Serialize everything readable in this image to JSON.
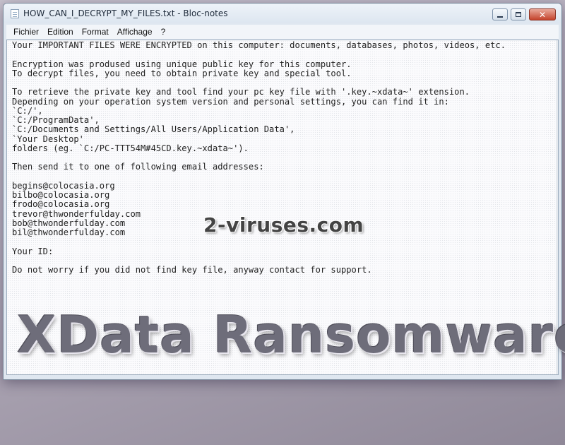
{
  "window": {
    "title": "HOW_CAN_I_DECRYPT_MY_FILES.txt - Bloc-notes",
    "app_icon": "notepad-icon",
    "controls": {
      "minimize_icon": "minimize-icon",
      "maximize_icon": "maximize-icon",
      "close_icon": "close-icon",
      "close_glyph": "✕"
    }
  },
  "menu": {
    "items": [
      {
        "label": "Fichier"
      },
      {
        "label": "Edition"
      },
      {
        "label": "Format"
      },
      {
        "label": "Affichage"
      },
      {
        "label": "?"
      }
    ]
  },
  "document": {
    "lines": [
      "Your IMPORTANT FILES WERE ENCRYPTED on this computer: documents, databases, photos, videos, etc.",
      "",
      "Encryption was prodused using unique public key for this computer.",
      "To decrypt files, you need to obtain private key and special tool.",
      "",
      "To retrieve the private key and tool find your pc key file with '.key.~xdata~' extension.",
      "Depending on your operation system version and personal settings, you can find it in:",
      "`C:/',",
      "`C:/ProgramData',",
      "`C:/Documents and Settings/All Users/Application Data',",
      "`Your Desktop'",
      "folders (eg. `C:/PC-TTT54M#45CD.key.~xdata~').",
      "",
      "Then send it to one of following email addresses:",
      "",
      "begins@colocasia.org",
      "bilbo@colocasia.org",
      "frodo@colocasia.org",
      "trevor@thwonderfulday.com",
      "bob@thwonderfulday.com",
      "bil@thwonderfulday.com",
      "",
      "Your ID:",
      "",
      "Do not worry if you did not find key file, anyway contact for support."
    ]
  },
  "watermarks": {
    "site": "2-viruses.com",
    "headline": "XData Ransomware"
  },
  "colors": {
    "close_button": "#c4432c",
    "titlebar": "#dde6f0",
    "headline_text": "#6e6d7a"
  }
}
